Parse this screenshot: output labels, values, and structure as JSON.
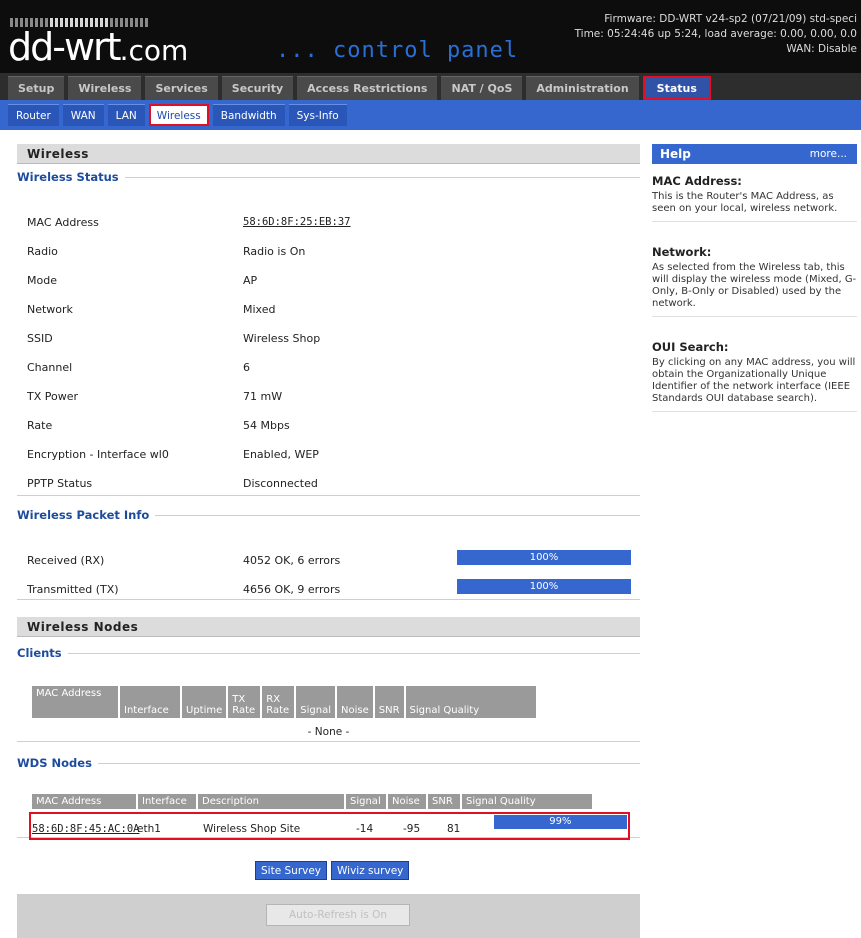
{
  "header": {
    "logo": "dd-wrt",
    "logo_domain": ".com",
    "subtitle": "... control panel",
    "firmware": "Firmware: DD-WRT v24-sp2 (07/21/09) std-speci",
    "time": "Time: 05:24:46 up 5:24, load average: 0.00, 0.00, 0.0",
    "wan": "WAN: Disable"
  },
  "main_tabs": [
    "Setup",
    "Wireless",
    "Services",
    "Security",
    "Access Restrictions",
    "NAT / QoS",
    "Administration",
    "Status"
  ],
  "sub_tabs": [
    "Router",
    "WAN",
    "LAN",
    "Wireless",
    "Bandwidth",
    "Sys-Info"
  ],
  "wireless": {
    "title": "Wireless",
    "status_legend": "Wireless Status",
    "status": [
      {
        "label": "MAC Address",
        "value": "58:6D:8F:25:EB:37"
      },
      {
        "label": "Radio",
        "value": "Radio is On"
      },
      {
        "label": "Mode",
        "value": "AP"
      },
      {
        "label": "Network",
        "value": "Mixed"
      },
      {
        "label": "SSID",
        "value": "Wireless Shop"
      },
      {
        "label": "Channel",
        "value": "6"
      },
      {
        "label": "TX Power",
        "value": "71 mW"
      },
      {
        "label": "Rate",
        "value": "54 Mbps"
      },
      {
        "label": "Encryption - Interface wl0",
        "value": "Enabled, WEP"
      },
      {
        "label": "PPTP Status",
        "value": "Disconnected"
      }
    ],
    "packet_legend": "Wireless Packet Info",
    "packets": [
      {
        "label": "Received (RX)",
        "value": "4052 OK, 6 errors",
        "bar": "100%",
        "fraction": 1.0
      },
      {
        "label": "Transmitted (TX)",
        "value": "4656 OK, 9 errors",
        "bar": "100%",
        "fraction": 1.0
      }
    ]
  },
  "nodes": {
    "title": "Wireless Nodes",
    "clients_legend": "Clients",
    "clients_headers": [
      "MAC Address",
      "Interface",
      "Uptime",
      "TX Rate",
      "RX Rate",
      "Signal",
      "Noise",
      "SNR",
      "Signal Quality"
    ],
    "clients_empty": "- None -",
    "wds_legend": "WDS Nodes",
    "wds_headers": [
      "MAC Address",
      "Interface",
      "Description",
      "Signal",
      "Noise",
      "SNR",
      "Signal Quality"
    ],
    "wds_rows": [
      {
        "mac": "58:6D:8F:45:AC:0A",
        "iface": "eth1",
        "desc": "Wireless Shop Site",
        "signal": "-14",
        "noise": "-95",
        "snr": "81",
        "quality": "99%",
        "quality_fraction": 0.99
      }
    ]
  },
  "buttons": {
    "site_survey": "Site Survey",
    "wiviz": "Wiviz survey",
    "auto_refresh": "Auto-Refresh is On"
  },
  "help": {
    "title": "Help",
    "more": "more...",
    "items": [
      {
        "heading": "MAC Address:",
        "text": "This is the Router's MAC Address, as seen on your local, wireless network."
      },
      {
        "heading": "Network:",
        "text": "As selected from the Wireless tab, this will display the wireless mode (Mixed, G-Only, B-Only or Disabled) used by the network."
      },
      {
        "heading": "OUI Search:",
        "text": "By clicking on any MAC address, you will obtain the Organizationally Unique Identifier of the network interface (IEEE Standards OUI database search)."
      }
    ]
  },
  "colors": {
    "accent": "#3567cf",
    "highlight": "#e01020"
  }
}
